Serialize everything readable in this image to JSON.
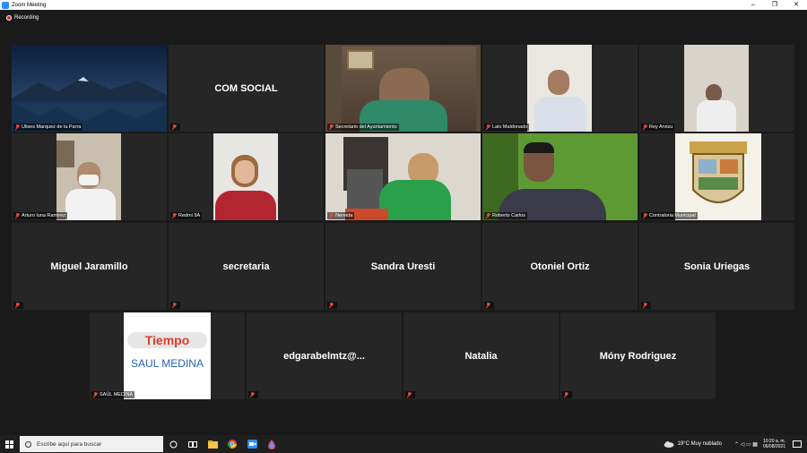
{
  "window": {
    "title": "Zoom Meeting",
    "controls": [
      "–",
      "❐",
      "✕"
    ]
  },
  "recording": {
    "label": "Recording"
  },
  "tiles": [
    {
      "name": "Ulises Marquez de la Parra",
      "big": "",
      "kind": "mountain"
    },
    {
      "name": "",
      "big": "COM SOCIAL",
      "kind": "text"
    },
    {
      "name": "Secretario del Ayuntamiento",
      "big": "",
      "kind": "video"
    },
    {
      "name": "Lalo Maldonado",
      "big": "",
      "kind": "video"
    },
    {
      "name": "Rey Arvizu",
      "big": "",
      "kind": "video"
    },
    {
      "name": "Arturo luna Ramirez",
      "big": "",
      "kind": "video"
    },
    {
      "name": "Redmi 9A",
      "big": "",
      "kind": "video"
    },
    {
      "name": "Nereida",
      "big": "",
      "kind": "video"
    },
    {
      "name": "Roberto Carlos",
      "big": "",
      "kind": "video"
    },
    {
      "name": "Contraloria Municipal",
      "big": "",
      "kind": "crest"
    },
    {
      "name": "",
      "big": "Miguel Jaramillo",
      "kind": "text"
    },
    {
      "name": "",
      "big": "secretaria",
      "kind": "text"
    },
    {
      "name": "",
      "big": "Sandra Uresti",
      "kind": "text"
    },
    {
      "name": "",
      "big": "Otoniel Ortiz",
      "kind": "text"
    },
    {
      "name": "",
      "big": "Sonia Uriegas",
      "kind": "text"
    },
    {
      "name": "SAÚL MEDINA",
      "big": "",
      "kind": "logo",
      "logo_top": "Tiempo",
      "logo_bottom": "SAUL MEDINA"
    },
    {
      "name": "",
      "big": "edgarabelmtz@...",
      "kind": "text"
    },
    {
      "name": "",
      "big": "Natalia",
      "kind": "text"
    },
    {
      "name": "",
      "big": "Mónу Rodriguez",
      "kind": "text"
    }
  ],
  "taskbar": {
    "search_placeholder": "Escribe aquí para buscar",
    "weather": "19°C  Muy nublado",
    "time": "10:20 a. m.",
    "date": "06/08/2021"
  }
}
